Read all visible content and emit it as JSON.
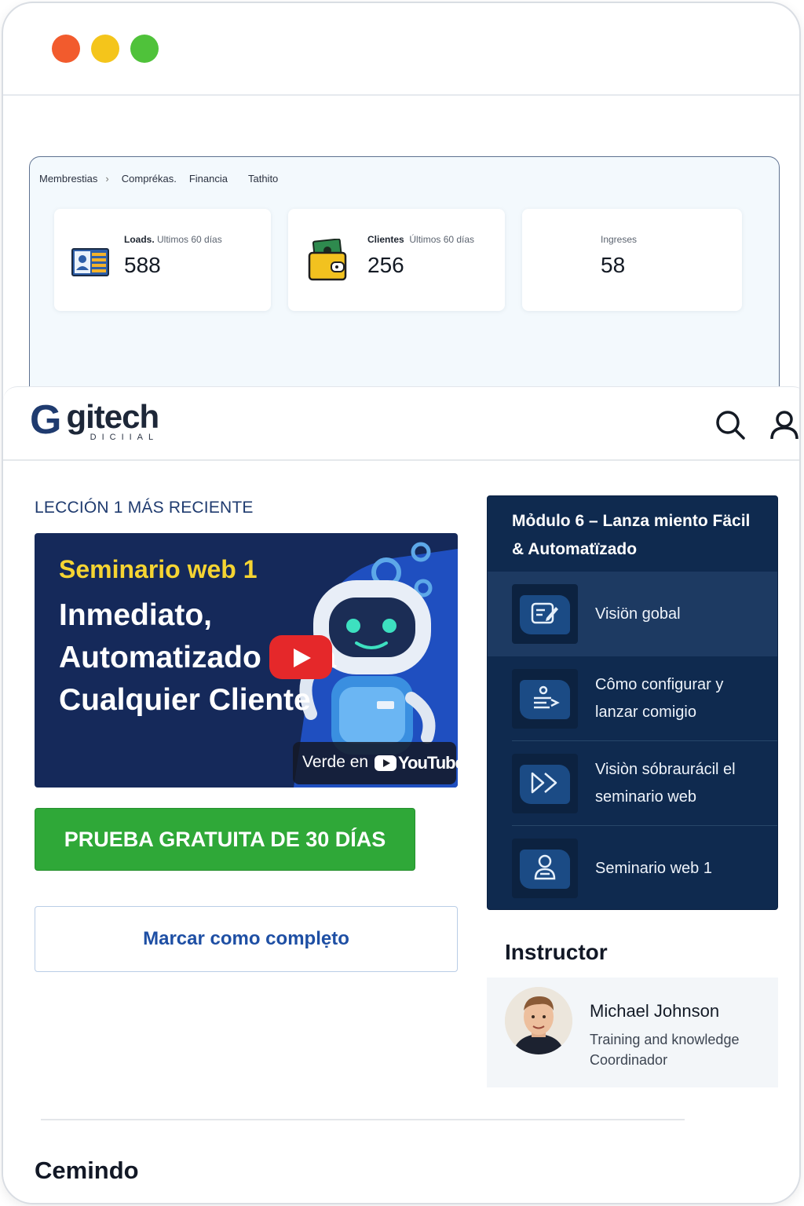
{
  "breadcrumb": {
    "item1": "Membrestias",
    "item2": "Comprékas.",
    "item3": "Financia",
    "item4": "Tathito"
  },
  "stats": [
    {
      "title": "Loads.",
      "period": "Ultimos 60 días",
      "value": "588",
      "icon": "id-card-icon"
    },
    {
      "title": "Clientes",
      "period": "Últimos 60 días",
      "value": "256",
      "icon": "wallet-icon"
    },
    {
      "title": "Ingreses",
      "period": "",
      "value": "58",
      "icon": ""
    }
  ],
  "brand": {
    "mark": "G",
    "name": "gitech",
    "tagline": "DICIIAL"
  },
  "lesson_section": {
    "title": "LECCIÓN 1 MÁS RECIENTE"
  },
  "video": {
    "kicker": "Seminario web 1",
    "headline": "Inmediato, Automatizado Para Cualquier Cliente",
    "watch_label": "Verde en",
    "youtube_label": "YouTube"
  },
  "cta": {
    "label": "PRUEBA GRATUITA DE 30 DÍAS"
  },
  "mark_complete": {
    "label": "Marcar como complẹto"
  },
  "module": {
    "title": "Mỏdulo 6 – Lanza miento Fäcil & Automatïzado",
    "lessons": [
      {
        "label": "Visiön gobal",
        "icon": "edit-note-icon",
        "active": true
      },
      {
        "label": "Cômo configurar y lanzar comigio",
        "icon": "list-arrow-icon",
        "active": false
      },
      {
        "label": "Visiòn sóbraurácil el seminario web",
        "icon": "fast-forward-icon",
        "active": false
      },
      {
        "label": "Seminario web 1",
        "icon": "person-icon",
        "active": false
      }
    ]
  },
  "instructor": {
    "heading": "Instructor",
    "name": "Michael Johnson",
    "role": "Training and knowledge Coordinador"
  },
  "footer": {
    "title": "Cemindo"
  },
  "colors": {
    "brand_navy": "#1f3b6f",
    "cta_green": "#2fa838",
    "module_bg": "#0f2a4f",
    "link_blue": "#1e4fa4",
    "kicker_yellow": "#f5d432",
    "youtube_red": "#e5282a"
  }
}
